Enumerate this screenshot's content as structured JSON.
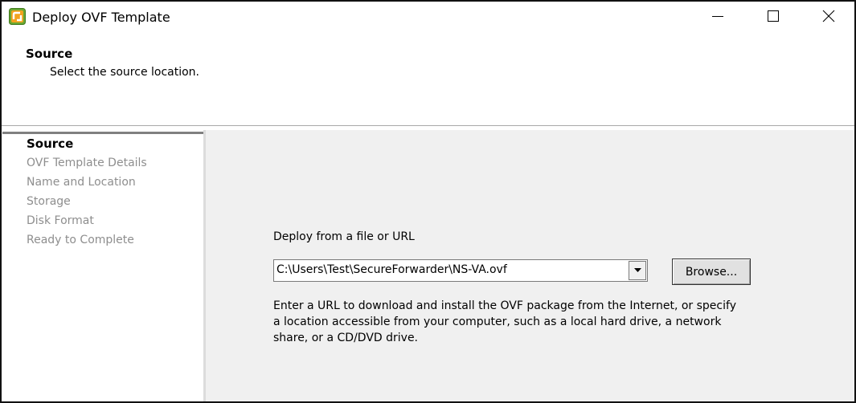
{
  "window": {
    "title": "Deploy OVF Template",
    "controls": {
      "minimize": "minimize-icon",
      "maximize": "maximize-icon",
      "close": "close-icon"
    }
  },
  "header": {
    "title": "Source",
    "subtitle": "Select the source location."
  },
  "nav": {
    "items": [
      {
        "label": "Source",
        "active": true
      },
      {
        "label": "OVF Template Details",
        "active": false
      },
      {
        "label": "Name and Location",
        "active": false
      },
      {
        "label": "Storage",
        "active": false
      },
      {
        "label": "Disk Format",
        "active": false
      },
      {
        "label": "Ready to Complete",
        "active": false
      }
    ]
  },
  "main": {
    "deploy_label": "Deploy from a file or URL",
    "path_value": "C:\\Users\\Test\\SecureForwarder\\NS-VA.ovf",
    "browse_label": "Browse...",
    "help_text": "Enter a URL to download and install the OVF package from the Internet, or specify a location accessible from your computer, such as a local hard drive, a network share, or a CD/DVD drive."
  },
  "colors": {
    "content_bg": "#f0f0f0",
    "nav_inactive": "#8e8e8e",
    "icon_green": "#5a9e2f",
    "icon_orange": "#f39a1e"
  }
}
